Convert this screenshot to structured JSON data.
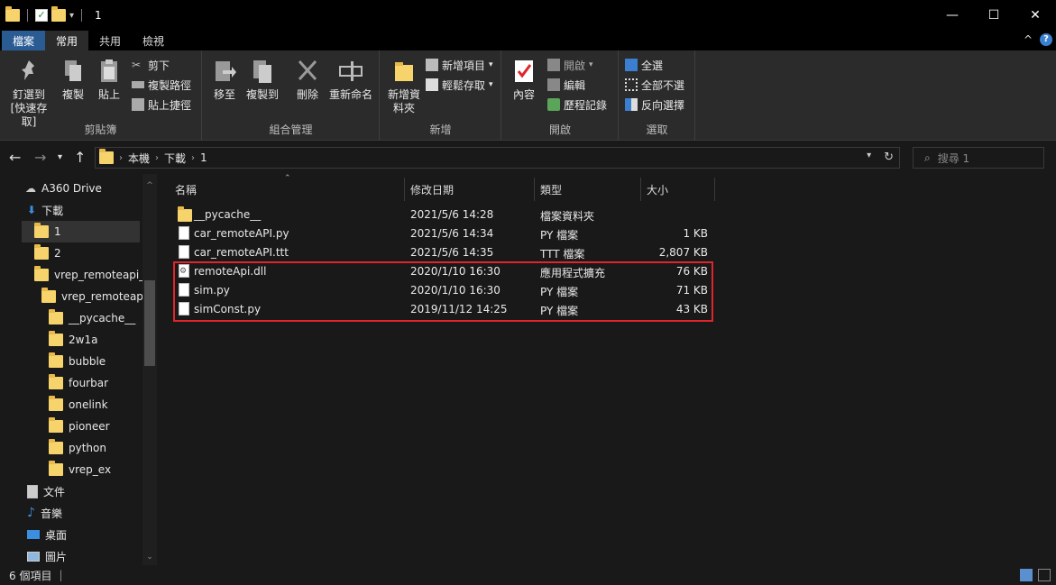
{
  "window": {
    "title": "1",
    "minimize": "—",
    "maximize": "☐",
    "close": "✕"
  },
  "tabs": {
    "file": "檔案",
    "home": "常用",
    "share": "共用",
    "view": "檢視",
    "collapse": "^",
    "help": "?"
  },
  "ribbon": {
    "clipboard": {
      "label": "剪貼簿",
      "pin": "釘選到 [快速存取]",
      "copy": "複製",
      "paste": "貼上",
      "cut": "剪下",
      "copy_path": "複製路徑",
      "paste_shortcut": "貼上捷徑"
    },
    "organize": {
      "label": "組合管理",
      "move_to": "移至",
      "copy_to": "複製到",
      "delete": "刪除",
      "rename": "重新命名"
    },
    "new": {
      "label": "新增",
      "new_folder": "新增資料夾",
      "new_item": "新增項目",
      "easy_access": "輕鬆存取"
    },
    "open": {
      "label": "開啟",
      "properties": "內容",
      "open": "開啟",
      "edit": "編輯",
      "history": "歷程記錄"
    },
    "select": {
      "label": "選取",
      "select_all": "全選",
      "select_none": "全部不選",
      "invert": "反向選擇"
    }
  },
  "address": {
    "crumbs": [
      "本機",
      "下載",
      "1"
    ],
    "search_placeholder": "搜尋 1"
  },
  "sidebar": {
    "items": [
      {
        "label": "A360 Drive",
        "icon": "cloud-icon"
      },
      {
        "label": "下載",
        "icon": "download-icon"
      },
      {
        "label": "1",
        "icon": "folder-icon"
      },
      {
        "label": "2",
        "icon": "folder-icon"
      },
      {
        "label": "vrep_remoteapi_e",
        "icon": "folder-icon"
      },
      {
        "label": "vrep_remoteapi_",
        "icon": "folder-icon"
      },
      {
        "label": "__pycache__",
        "icon": "folder-icon"
      },
      {
        "label": "2w1a",
        "icon": "folder-icon"
      },
      {
        "label": "bubble",
        "icon": "folder-icon"
      },
      {
        "label": "fourbar",
        "icon": "folder-icon"
      },
      {
        "label": "onelink",
        "icon": "folder-icon"
      },
      {
        "label": "pioneer",
        "icon": "folder-icon"
      },
      {
        "label": "python",
        "icon": "folder-icon"
      },
      {
        "label": "vrep_ex",
        "icon": "folder-icon"
      },
      {
        "label": "文件",
        "icon": "document-icon"
      },
      {
        "label": "音樂",
        "icon": "music-icon"
      },
      {
        "label": "桌面",
        "icon": "desktop-icon"
      },
      {
        "label": "圖片",
        "icon": "pictures-icon"
      }
    ]
  },
  "files": {
    "columns": [
      "名稱",
      "修改日期",
      "類型",
      "大小"
    ],
    "rows": [
      {
        "name": "__pycache__",
        "date": "2021/5/6 14:28",
        "type": "檔案資料夾",
        "size": "",
        "icon": "folder-icon"
      },
      {
        "name": "car_remoteAPI.py",
        "date": "2021/5/6 14:34",
        "type": "PY 檔案",
        "size": "1 KB",
        "icon": "file-icon"
      },
      {
        "name": "car_remoteAPI.ttt",
        "date": "2021/5/6 14:35",
        "type": "TTT 檔案",
        "size": "2,807 KB",
        "icon": "file-icon"
      },
      {
        "name": "remoteApi.dll",
        "date": "2020/1/10 16:30",
        "type": "應用程式擴充",
        "size": "76 KB",
        "icon": "dll-icon"
      },
      {
        "name": "sim.py",
        "date": "2020/1/10 16:30",
        "type": "PY 檔案",
        "size": "71 KB",
        "icon": "file-icon"
      },
      {
        "name": "simConst.py",
        "date": "2019/11/12 14:25",
        "type": "PY 檔案",
        "size": "43 KB",
        "icon": "file-icon"
      }
    ]
  },
  "status": {
    "count": "6 個項目",
    "sep": "|"
  },
  "colors": {
    "highlight_box": "#e0242c",
    "file_tab": "#2a5b93",
    "folder": "#f7d36b"
  }
}
